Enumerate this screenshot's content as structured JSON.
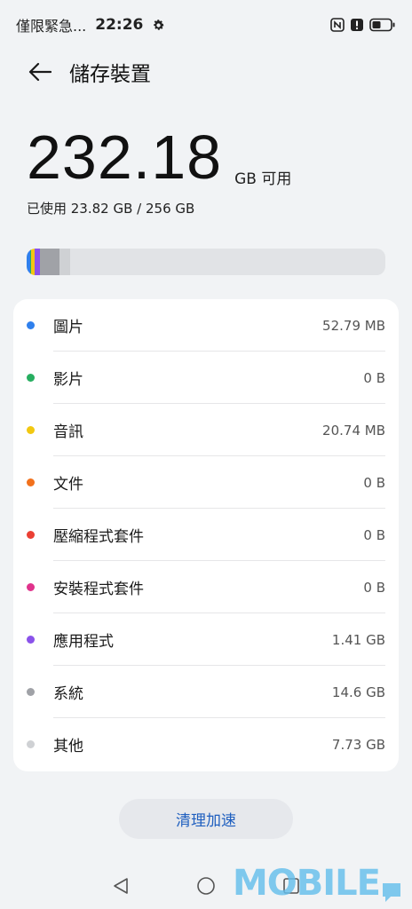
{
  "status_bar": {
    "carrier": "僅限緊急...",
    "time": "22:26",
    "icons": [
      "gear-icon",
      "nfc-icon",
      "alert-icon",
      "battery-icon"
    ]
  },
  "header": {
    "title": "儲存裝置",
    "back_icon": "back-arrow-icon"
  },
  "summary": {
    "available": "232.18",
    "available_unit": "GB 可用",
    "used_line": "已使用 23.82 GB / 256 GB"
  },
  "usage_bar": {
    "used_fraction": 0.093,
    "segments": [
      {
        "category": "圖片",
        "color": "#2f80ed"
      },
      {
        "category": "影片",
        "color": "#27ae60"
      },
      {
        "category": "音訊",
        "color": "#f2c811"
      },
      {
        "category": "文件",
        "color": "#f2711c"
      },
      {
        "category": "壓縮程式套件",
        "color": "#eb4034"
      },
      {
        "category": "安裝程式套件",
        "color": "#e0338c"
      },
      {
        "category": "應用程式",
        "color": "#8a52ea"
      },
      {
        "category": "系統",
        "color": "#a0a2a7"
      },
      {
        "category": "其他",
        "color": "#cfd1d4"
      }
    ]
  },
  "categories": [
    {
      "label": "圖片",
      "value": "52.79 MB",
      "color": "#2f80ed"
    },
    {
      "label": "影片",
      "value": "0 B",
      "color": "#27ae60"
    },
    {
      "label": "音訊",
      "value": "20.74 MB",
      "color": "#f2c811"
    },
    {
      "label": "文件",
      "value": "0 B",
      "color": "#f2711c"
    },
    {
      "label": "壓縮程式套件",
      "value": "0 B",
      "color": "#eb4034"
    },
    {
      "label": "安裝程式套件",
      "value": "0 B",
      "color": "#e0338c"
    },
    {
      "label": "應用程式",
      "value": "1.41 GB",
      "color": "#8a52ea"
    },
    {
      "label": "系統",
      "value": "14.6 GB",
      "color": "#a0a2a7"
    },
    {
      "label": "其他",
      "value": "7.73 GB",
      "color": "#cfd1d4"
    }
  ],
  "clean_button": {
    "label": "清理加速"
  },
  "nav_bar": {
    "icons": [
      "nav-back-icon",
      "nav-home-icon",
      "nav-recent-icon"
    ]
  },
  "watermark": {
    "text": "MOBILE"
  },
  "colors": {
    "background": "#f1f3f5",
    "card": "#ffffff",
    "accent": "#1f5fbf",
    "bar_track": "#e1e3e6"
  }
}
